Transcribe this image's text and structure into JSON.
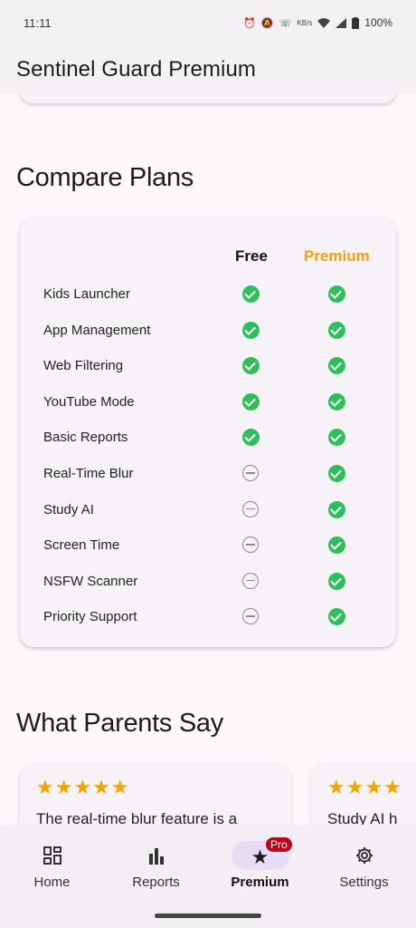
{
  "status_bar": {
    "time": "11:11",
    "battery": "100%",
    "icons": [
      "alarm-icon",
      "mute-icon",
      "wifi-call-icon",
      "data-speed-icon",
      "wifi-icon",
      "signal-icon",
      "battery-icon"
    ],
    "data_speed": "KB/s"
  },
  "app_bar": {
    "title": "Sentinel Guard Premium"
  },
  "compare": {
    "title": "Compare Plans",
    "free_label": "Free",
    "premium_label": "Premium",
    "premium_color": "#f4a000",
    "features": [
      {
        "name": "Kids Launcher",
        "free": true,
        "premium": true
      },
      {
        "name": "App Management",
        "free": true,
        "premium": true
      },
      {
        "name": "Web Filtering",
        "free": true,
        "premium": true
      },
      {
        "name": "YouTube Mode",
        "free": true,
        "premium": true
      },
      {
        "name": "Basic Reports",
        "free": true,
        "premium": true
      },
      {
        "name": "Real-Time Blur",
        "free": false,
        "premium": true
      },
      {
        "name": "Study AI",
        "free": false,
        "premium": true
      },
      {
        "name": "Screen Time",
        "free": false,
        "premium": true
      },
      {
        "name": "NSFW Scanner",
        "free": false,
        "premium": true
      },
      {
        "name": "Priority Support",
        "free": false,
        "premium": true
      }
    ]
  },
  "parents": {
    "title": "What Parents Say",
    "reviews": [
      {
        "stars": "★★★★★",
        "text": "The real-time blur feature is a"
      },
      {
        "stars": "★★★★",
        "text": "Study AI h"
      }
    ]
  },
  "bottom_nav": {
    "items": [
      {
        "label": "Home",
        "icon": "dashboard-icon"
      },
      {
        "label": "Reports",
        "icon": "bar-chart-icon"
      },
      {
        "label": "Premium",
        "icon": "star-icon",
        "badge": "Pro"
      },
      {
        "label": "Settings",
        "icon": "gear-icon"
      }
    ]
  }
}
